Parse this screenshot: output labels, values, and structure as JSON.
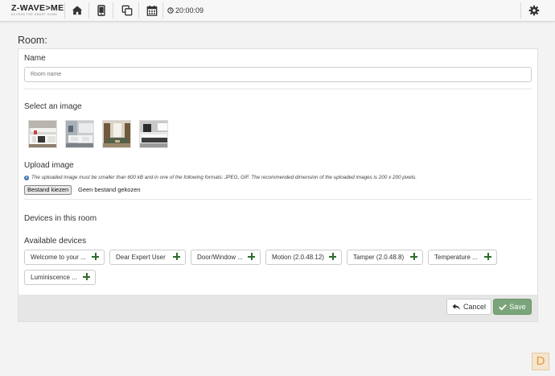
{
  "app": {
    "logo_main": "Z-WAVE>ME",
    "logo_sub": "ACCESS THE SMART HOME",
    "clock": "20:00:09"
  },
  "icons": {
    "home": "home-icon",
    "devices": "tablet-icon",
    "rooms": "copy-icon",
    "events": "calendar-icon",
    "clock": "clock-icon",
    "settings": "gear-icon"
  },
  "page": {
    "title": "Room:"
  },
  "form": {
    "name_label": "Name",
    "name_placeholder": "Room name",
    "name_value": "",
    "select_image_label": "Select an image",
    "upload_label": "Upload image",
    "upload_info": "The uploaded image must be smaller than 600 kB and in one of the following formats: JPEG, GIF. The recommended dimension of the uploaded images is 200 x 200 pixels.",
    "file_button": "Bestand kiezen",
    "file_status": "Geen bestand gekozen",
    "devices_in_room_label": "Devices in this room",
    "available_devices_label": "Available devices",
    "available_devices": [
      "Welcome to your ...",
      "Dear Expert User",
      "Door/Window ...",
      "Motion (2.0.48.12)",
      "Tamper (2.0.48.8)",
      "Temperature ...",
      "Luminiscence ..."
    ]
  },
  "footer": {
    "cancel_label": "Cancel",
    "save_label": "Save"
  },
  "corner_badge": "D",
  "colors": {
    "save_green": "#7aa57a",
    "plus_green": "#2e6b2e",
    "info_blue": "#3a6fb0",
    "badge_orange": "#e39a3a"
  }
}
